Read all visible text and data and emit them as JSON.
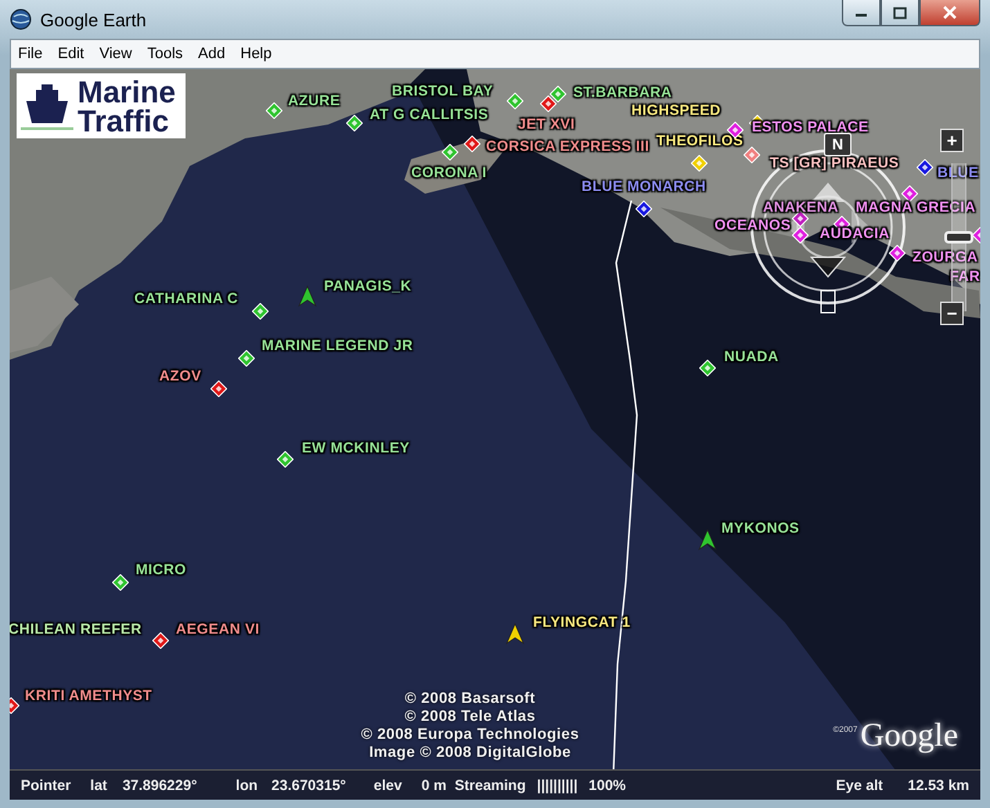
{
  "window": {
    "title": "Google Earth"
  },
  "menu": [
    "File",
    "Edit",
    "View",
    "Tools",
    "Add",
    "Help"
  ],
  "logo": {
    "line_1": "Marine",
    "line_2": "Traffic"
  },
  "vessels": [
    {
      "name": "AZURE",
      "kind": "diamond",
      "color": "#2fc42f"
    },
    {
      "name": "BRISTOL BAY",
      "kind": "diamond",
      "color": "#2fc42f"
    },
    {
      "name": "AT G CALLITSIS",
      "kind": "diamond",
      "color": "#2fc42f"
    },
    {
      "name": "ST.BARBARA",
      "kind": "diamond",
      "color": "#2fc42f"
    },
    {
      "name": "JET XVI",
      "kind": "diamond",
      "color": "#e01818"
    },
    {
      "name": "HIGHSPEED",
      "kind": "diamond",
      "color": "#f0d000"
    },
    {
      "name": "CORSICA EXPRESS III",
      "kind": "diamond",
      "color": "#e01818"
    },
    {
      "name": "CORONA I",
      "kind": "diamond",
      "color": "#2fc42f"
    },
    {
      "name": "THEOFILOS",
      "kind": "diamond",
      "color": "#f0d000"
    },
    {
      "name": "BLUE MONARCH",
      "kind": "diamond",
      "color": "#1818e0"
    },
    {
      "name": "ESTOS PALACE",
      "kind": "diamond",
      "color": "#e020e0"
    },
    {
      "name": "TS [GR] PIRAEUS",
      "kind": "diamond",
      "color": "#f08080"
    },
    {
      "name": "BLUE",
      "kind": "diamond",
      "color": "#1818e0"
    },
    {
      "name": "ANAKENA",
      "kind": "diamond",
      "color": "#c020c0"
    },
    {
      "name": "MAGNA GRECIA",
      "kind": "diamond",
      "color": "#e020e0"
    },
    {
      "name": "OCEANOS",
      "kind": "diamond",
      "color": "#e020e0"
    },
    {
      "name": "AUDACIA",
      "kind": "diamond",
      "color": "#e020e0"
    },
    {
      "name": "ZOURGA",
      "kind": "diamond",
      "color": "#e020e0"
    },
    {
      "name": "FAR",
      "kind": "diamond",
      "color": "#e020e0"
    },
    {
      "name": "CATHARINA C",
      "kind": "diamond",
      "color": "#2fc42f"
    },
    {
      "name": "PANAGIS_K",
      "kind": "arrow",
      "color": "#2fc42f"
    },
    {
      "name": "MARINE LEGEND JR",
      "kind": "diamond",
      "color": "#2fc42f"
    },
    {
      "name": "AZOV",
      "kind": "diamond",
      "color": "#e01818"
    },
    {
      "name": "NUADA",
      "kind": "diamond",
      "color": "#2fc42f"
    },
    {
      "name": "EW MCKINLEY",
      "kind": "diamond",
      "color": "#2fc42f"
    },
    {
      "name": "MYKONOS",
      "kind": "arrow",
      "color": "#2fc42f"
    },
    {
      "name": "MICRO",
      "kind": "diamond",
      "color": "#2fc42f"
    },
    {
      "name": "CHILEAN REEFER",
      "kind": "none"
    },
    {
      "name": "AEGEAN VI",
      "kind": "diamond",
      "color": "#e01818"
    },
    {
      "name": "FLYINGCAT 1",
      "kind": "arrow",
      "color": "#f0d000"
    },
    {
      "name": "KRITI AMETHYST",
      "kind": "diamond",
      "color": "#e01818"
    }
  ],
  "navigation": {
    "compass_label": "N",
    "zoom_in": "+",
    "zoom_out": "−",
    "zoom_slider": {
      "level": 0.5
    }
  },
  "copyright": [
    "© 2008 Basarsoft",
    "© 2008 Tele Atlas",
    "© 2008 Europa Technologies",
    "Image © 2008 DigitalGlobe"
  ],
  "brand": {
    "year": "©2007",
    "name": "Google"
  },
  "status_bar": {
    "pointer": "Pointer",
    "lat_label": "lat",
    "lat": "37.896229°",
    "lon_label": "lon",
    "lon": "23.670315°",
    "elev_label": "elev",
    "elev": "0 m",
    "streaming": "Streaming",
    "streaming_bar": "||||||||||",
    "streaming_percent": "100%",
    "eye_alt_label": "Eye alt",
    "eye_alt": "12.53 km"
  }
}
